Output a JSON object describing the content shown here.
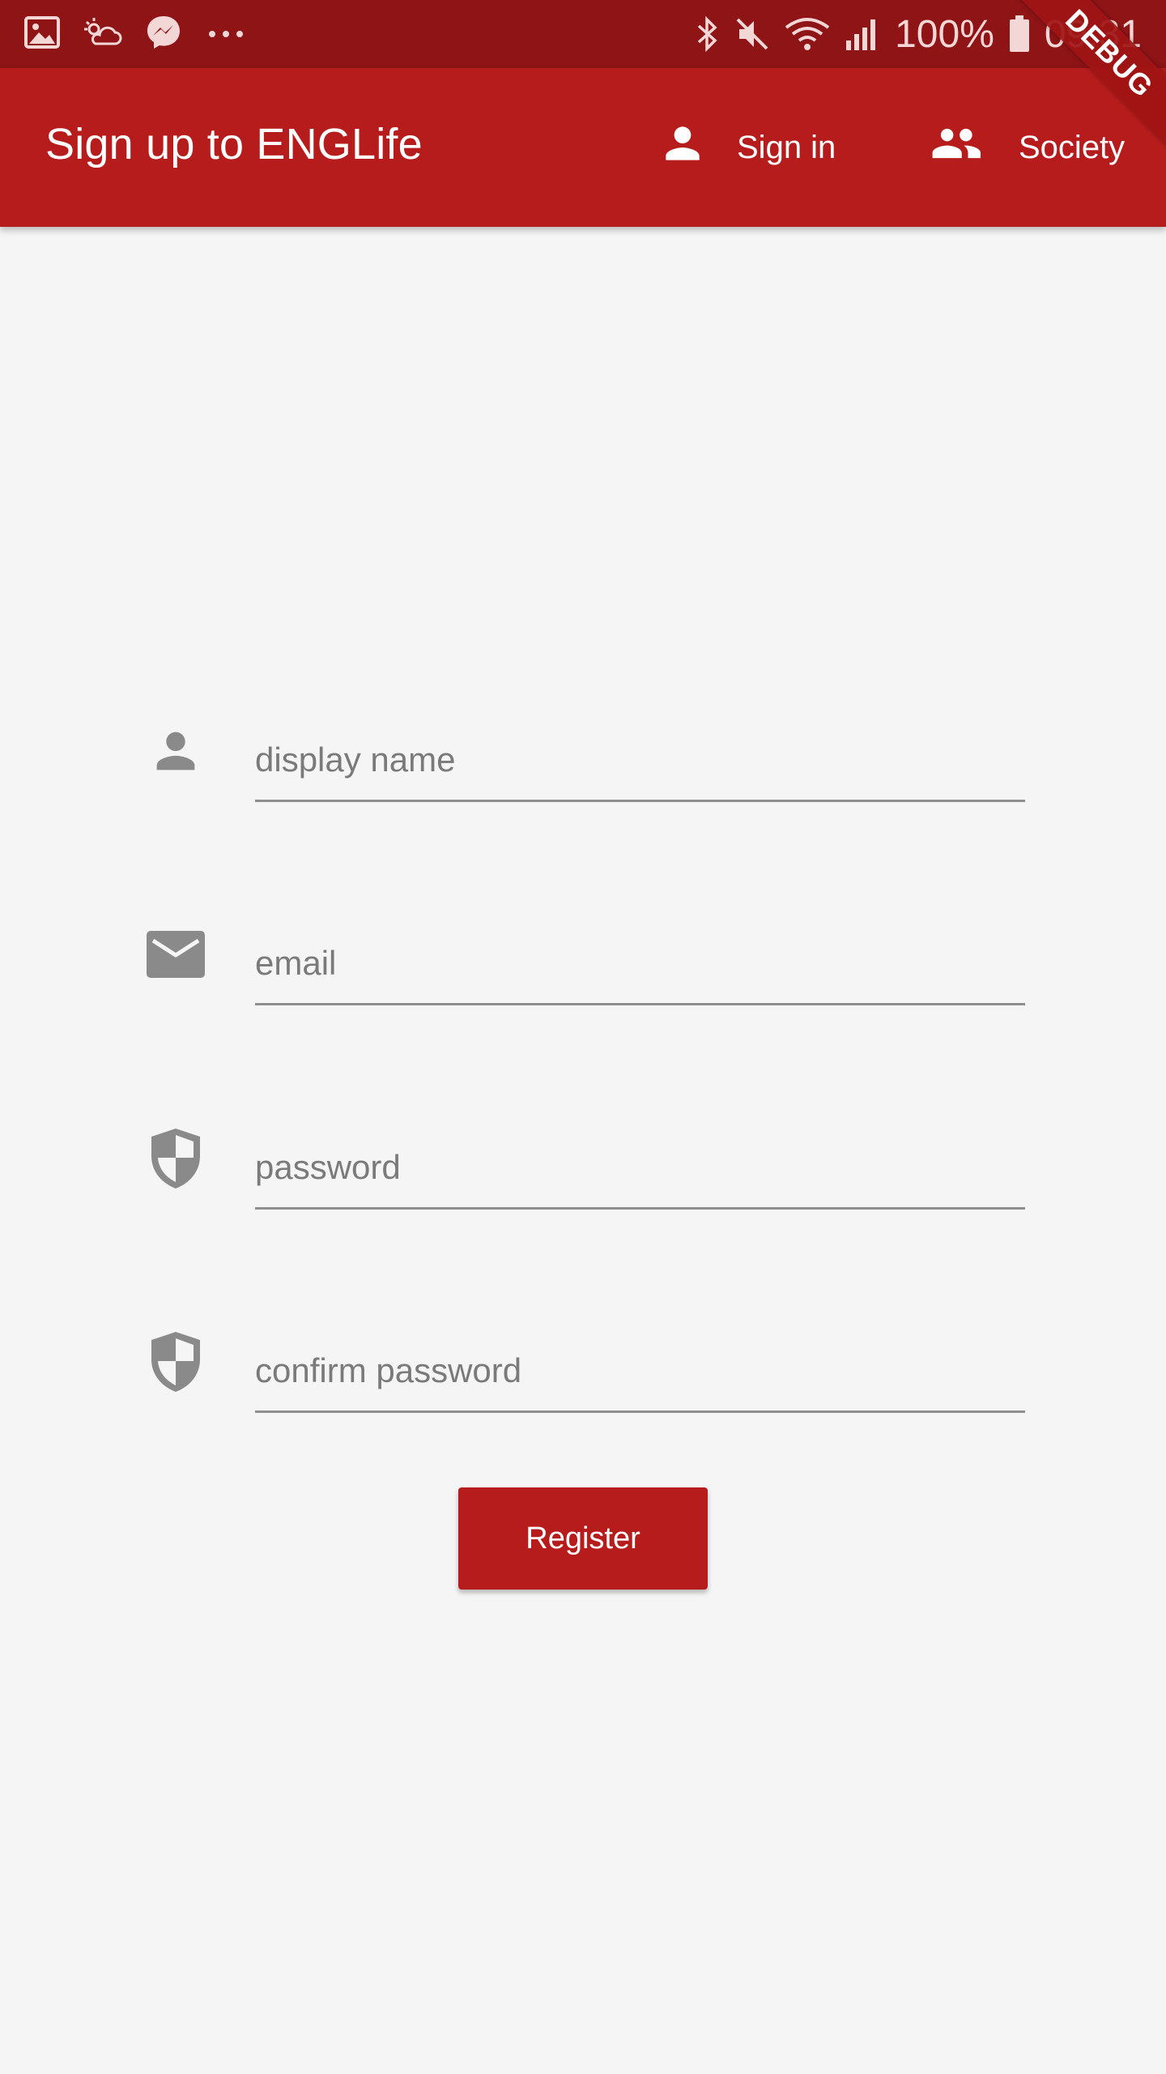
{
  "status_bar": {
    "battery": "100%",
    "time": "09:31",
    "icons": [
      "gallery-icon",
      "weather-icon",
      "messenger-icon",
      "more-dots-icon",
      "bluetooth-icon",
      "mute-icon",
      "wifi-icon",
      "signal-icon",
      "battery-icon"
    ]
  },
  "app_bar": {
    "title": "Sign up to ENGLife",
    "sign_in_label": "Sign in",
    "society_label": "Society",
    "background": "#b71c1c"
  },
  "debug_banner": {
    "label": "DEBUG"
  },
  "form": {
    "display_name": {
      "placeholder": "display name",
      "value": "",
      "icon": "person-icon"
    },
    "email": {
      "placeholder": "email",
      "value": "",
      "icon": "email-icon"
    },
    "password": {
      "placeholder": "password",
      "value": "",
      "icon": "shield-icon"
    },
    "confirm_password": {
      "placeholder": "confirm password",
      "value": "",
      "icon": "shield-icon"
    },
    "register_label": "Register"
  },
  "colors": {
    "accent": "#b71c1c",
    "status_bar": "#8e1416",
    "icon_gray": "#8a8a8a",
    "background": "#f5f5f5"
  }
}
